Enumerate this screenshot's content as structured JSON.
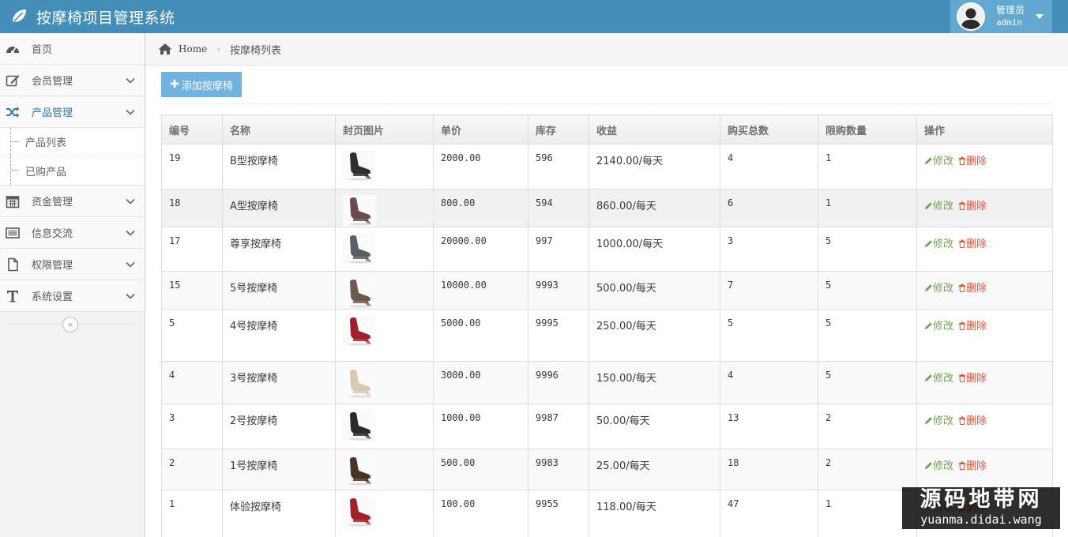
{
  "app": {
    "title": "按摩椅项目管理系统"
  },
  "user": {
    "role": "管理员",
    "name": "admin"
  },
  "sidebar": {
    "items": [
      {
        "label": "首页",
        "icon": "dashboard-icon"
      },
      {
        "label": "会员管理",
        "icon": "edit-icon"
      },
      {
        "label": "产品管理",
        "icon": "shuffle-icon",
        "active": true
      },
      {
        "label": "资金管理",
        "icon": "calendar-icon"
      },
      {
        "label": "信息交流",
        "icon": "list-alt-icon"
      },
      {
        "label": "权限管理",
        "icon": "file-icon"
      },
      {
        "label": "系统设置",
        "icon": "text-icon"
      }
    ],
    "submenu": [
      {
        "label": "产品列表"
      },
      {
        "label": "已购产品"
      }
    ]
  },
  "breadcrumb": {
    "home": "Home",
    "current": "按摩椅列表"
  },
  "toolbar": {
    "add_label": "添加按摩椅"
  },
  "table": {
    "headers": [
      "编号",
      "名称",
      "封页图片",
      "单价",
      "库存",
      "收益",
      "购买总数",
      "限购数量",
      "操作"
    ],
    "edit_label": "修改",
    "delete_label": "删除",
    "rows": [
      {
        "id": "19",
        "name": "B型按摩椅",
        "price": "2000.00",
        "stock": "596",
        "income": "2140.00/每天",
        "total": "4",
        "limit": "1",
        "chair_color": "#2f2f2f"
      },
      {
        "id": "18",
        "name": "A型按摩椅",
        "price": "800.00",
        "stock": "594",
        "income": "860.00/每天",
        "total": "6",
        "limit": "1",
        "chair_color": "#6b4a4a"
      },
      {
        "id": "17",
        "name": "尊享按摩椅",
        "price": "20000.00",
        "stock": "997",
        "income": "1000.00/每天",
        "total": "3",
        "limit": "5",
        "chair_color": "#5a5e66"
      },
      {
        "id": "15",
        "name": "5号按摩椅",
        "price": "10000.00",
        "stock": "9993",
        "income": "500.00/每天",
        "total": "7",
        "limit": "5",
        "chair_color": "#6e5a4c"
      },
      {
        "id": "5",
        "name": "4号按摩椅",
        "price": "5000.00",
        "stock": "9995",
        "income": "250.00/每天",
        "total": "5",
        "limit": "5",
        "chair_color": "#a3202b"
      },
      {
        "id": "4",
        "name": "3号按摩椅",
        "price": "3000.00",
        "stock": "9996",
        "income": "150.00/每天",
        "total": "4",
        "limit": "5",
        "chair_color": "#d9c8b4"
      },
      {
        "id": "3",
        "name": "2号按摩椅",
        "price": "1000.00",
        "stock": "9987",
        "income": "50.00/每天",
        "total": "13",
        "limit": "2",
        "chair_color": "#2a2a2a"
      },
      {
        "id": "2",
        "name": "1号按摩椅",
        "price": "500.00",
        "stock": "9983",
        "income": "25.00/每天",
        "total": "18",
        "limit": "2",
        "chair_color": "#4a3226"
      },
      {
        "id": "1",
        "name": "体验按摩椅",
        "price": "100.00",
        "stock": "9955",
        "income": "118.00/每天",
        "total": "47",
        "limit": "1",
        "chair_color": "#a3202b"
      }
    ]
  },
  "watermark": {
    "line1": "源码地带网",
    "line2": "yuanma.didai.wang"
  },
  "colors": {
    "navbar": "#438eb9",
    "user_box": "#62a8d1",
    "add_button": "#6fb3e0",
    "active": "#2b7dbc",
    "edit": "#69aa46",
    "delete": "#dd5a43"
  }
}
